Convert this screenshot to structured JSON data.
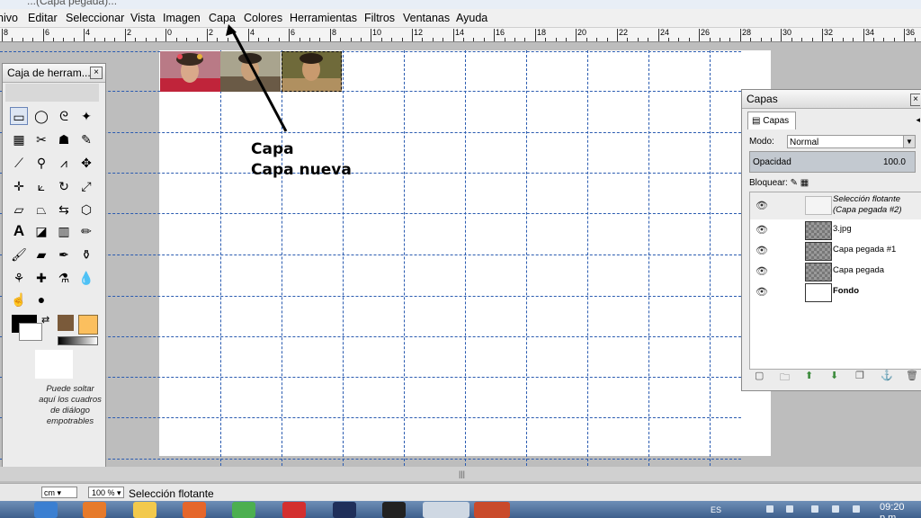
{
  "window": {
    "title_fragment": "...(Capa pegada)..."
  },
  "menubar": [
    "nivo",
    "Editar",
    "Seleccionar",
    "Vista",
    "Imagen",
    "Capa",
    "Colores",
    "Herramientas",
    "Filtros",
    "Ventanas",
    "Ayuda"
  ],
  "ruler": {
    "labels": [
      "8",
      "6",
      "4",
      "2",
      "0",
      "2",
      "4",
      "6",
      "8",
      "10",
      "12",
      "14",
      "16",
      "18",
      "20",
      "22",
      "24",
      "26",
      "28",
      "30",
      "32",
      "34",
      "36"
    ]
  },
  "annotation": {
    "line1": "Capa",
    "line2": "Capa nueva"
  },
  "toolbox": {
    "title": "Caja de herram...",
    "close": "×",
    "hint": "Puede soltar aquí los cuadros de diálogo empotrables"
  },
  "layers_panel": {
    "title": "Capas",
    "close": "×",
    "tab_label": "Capas",
    "mode_label": "Modo:",
    "mode_value": "Normal",
    "opacity_label": "Opacidad",
    "opacity_value": "100.0",
    "lock_label": "Bloquear:",
    "layers": [
      {
        "name": "Selección flotante (Capa pegada #2)",
        "visible": true,
        "selected": true,
        "italic": true
      },
      {
        "name": "3.jpg",
        "visible": true
      },
      {
        "name": "Capa pegada #1",
        "visible": true
      },
      {
        "name": "Capa pegada",
        "visible": true
      },
      {
        "name": "Fondo",
        "visible": true,
        "bold": true
      }
    ]
  },
  "statusbar": {
    "unit": "cm",
    "zoom": "100 %",
    "message": "Selección flotante"
  },
  "taskbar": {
    "language": "ES",
    "clock": "09:20 p.m."
  },
  "colors": {
    "guide": "#2a5bb0",
    "canvas": "#ffffff",
    "taskbar": "#3e5f8c"
  }
}
